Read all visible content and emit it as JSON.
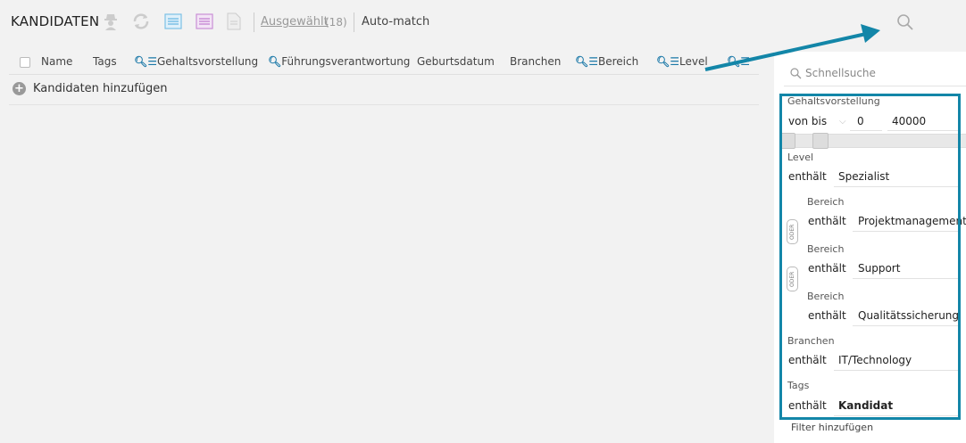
{
  "toolbar": {
    "title": "KANDIDATEN",
    "selected_label": "Ausgewählt",
    "selected_count": "(18)",
    "automatch_label": "Auto-match"
  },
  "columns": {
    "name": "Name",
    "tags": "Tags",
    "gehalt": "Gehaltsvorstellung",
    "fuehrung": "Führungsverantwortung",
    "geburt": "Geburtsdatum",
    "branchen": "Branchen",
    "bereich": "Bereich",
    "level": "Level"
  },
  "add_candidates": "Kandidaten hinzufügen",
  "filters": {
    "quick_search_placeholder": "Schnellsuche",
    "gehalt": {
      "label": "Gehaltsvorstellung",
      "op": "von bis",
      "min": "0",
      "max": "40000"
    },
    "level": {
      "label": "Level",
      "op": "enthält",
      "value": "Spezialist"
    },
    "bereich": [
      {
        "label": "Bereich",
        "op": "enthält",
        "value": "Projektmanagement"
      },
      {
        "label": "Bereich",
        "op": "enthält",
        "value": "Support"
      },
      {
        "label": "Bereich",
        "op": "enthält",
        "value": "Qualitätssicherung"
      }
    ],
    "oder_label": "ODER",
    "branchen": {
      "label": "Branchen",
      "op": "enthält",
      "value": "IT/Technology"
    },
    "tags": {
      "label": "Tags",
      "op": "enthält",
      "value": "Kandidat"
    },
    "add_filter": "Filter hinzufügen"
  },
  "colors": {
    "accent": "#1386a8",
    "icon_blue": "#1a78a8"
  }
}
